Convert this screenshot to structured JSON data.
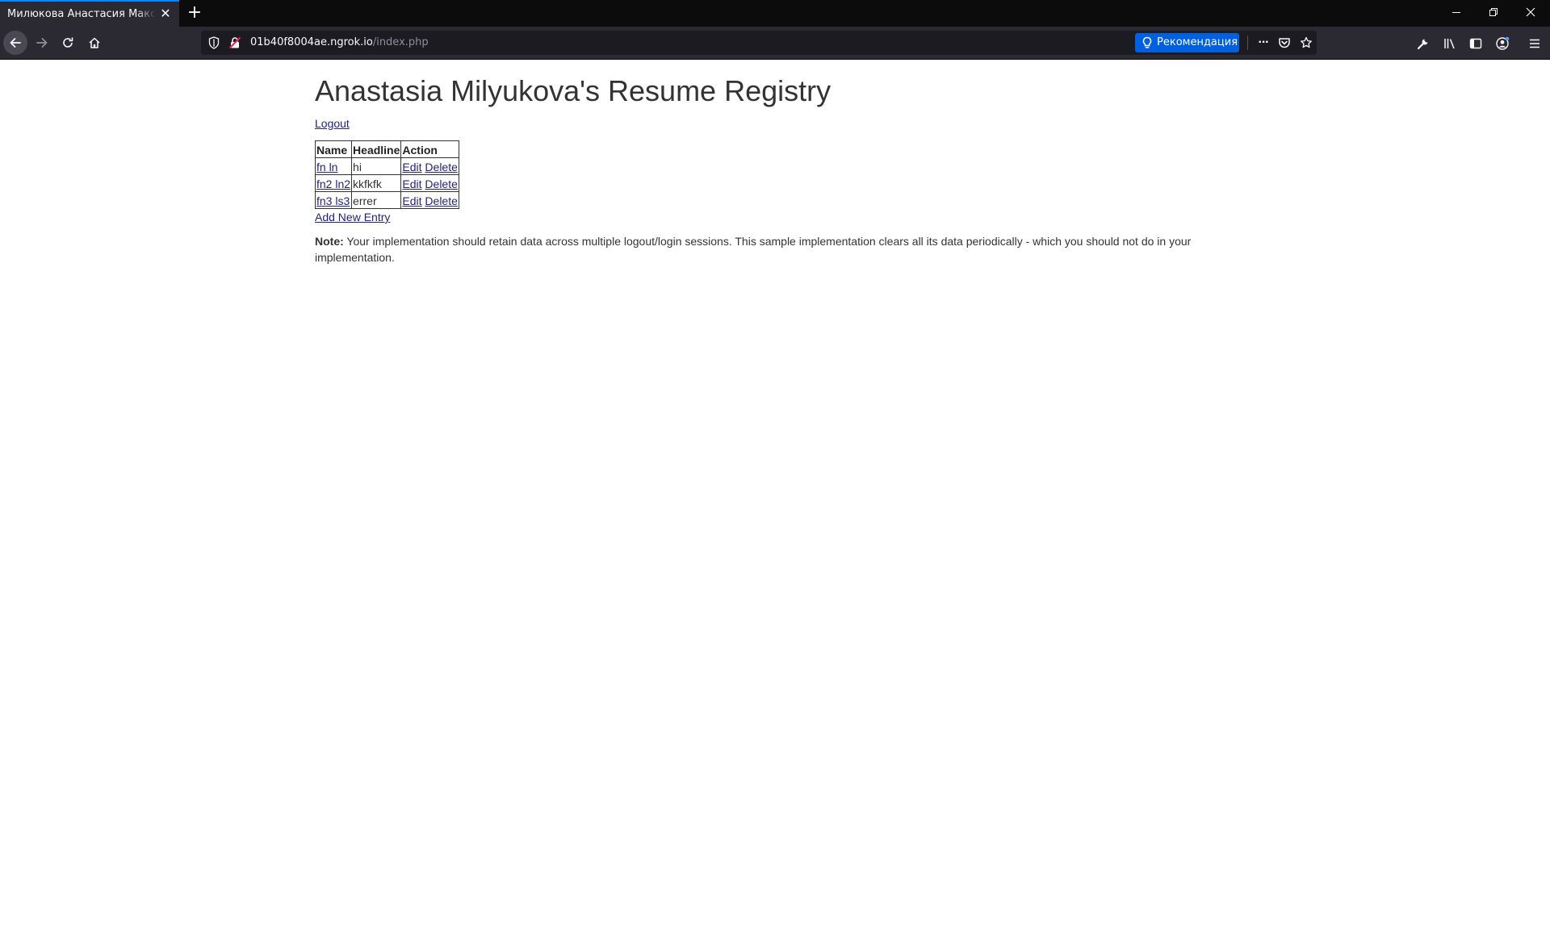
{
  "browser": {
    "tab_title": "Милюкова Анастасия Максимовна",
    "tab_close_glyph": "✕",
    "newtab_glyph": "+",
    "url_host": "01b40f8004ae.ngrok.io",
    "url_path": "/index.php",
    "recommend_label": "Рекомендация",
    "more_glyph": "···"
  },
  "page": {
    "title": "Anastasia Milyukova's Resume Registry",
    "logout_label": "Logout",
    "table": {
      "headers": [
        "Name",
        "Headline",
        "Action"
      ],
      "rows": [
        {
          "name": "fn ln",
          "headline": "hi",
          "edit": "Edit",
          "delete": "Delete"
        },
        {
          "name": "fn2 ln2",
          "headline": "kkfkfk",
          "edit": "Edit",
          "delete": "Delete"
        },
        {
          "name": "fn3 ls3",
          "headline": "errer",
          "edit": "Edit",
          "delete": "Delete"
        }
      ]
    },
    "add_entry_label": "Add New Entry",
    "note_label": "Note:",
    "note_text": " Your implementation should retain data across multiple logout/login sessions. This sample implementation clears all its data periodically - which you should not do in your implementation."
  },
  "colors": {
    "chrome_dark": "#0c0c0d",
    "toolbar": "#2b2a33",
    "urlbar": "#1c1b22",
    "accent_blue": "#0060df",
    "link": "#23237e"
  }
}
